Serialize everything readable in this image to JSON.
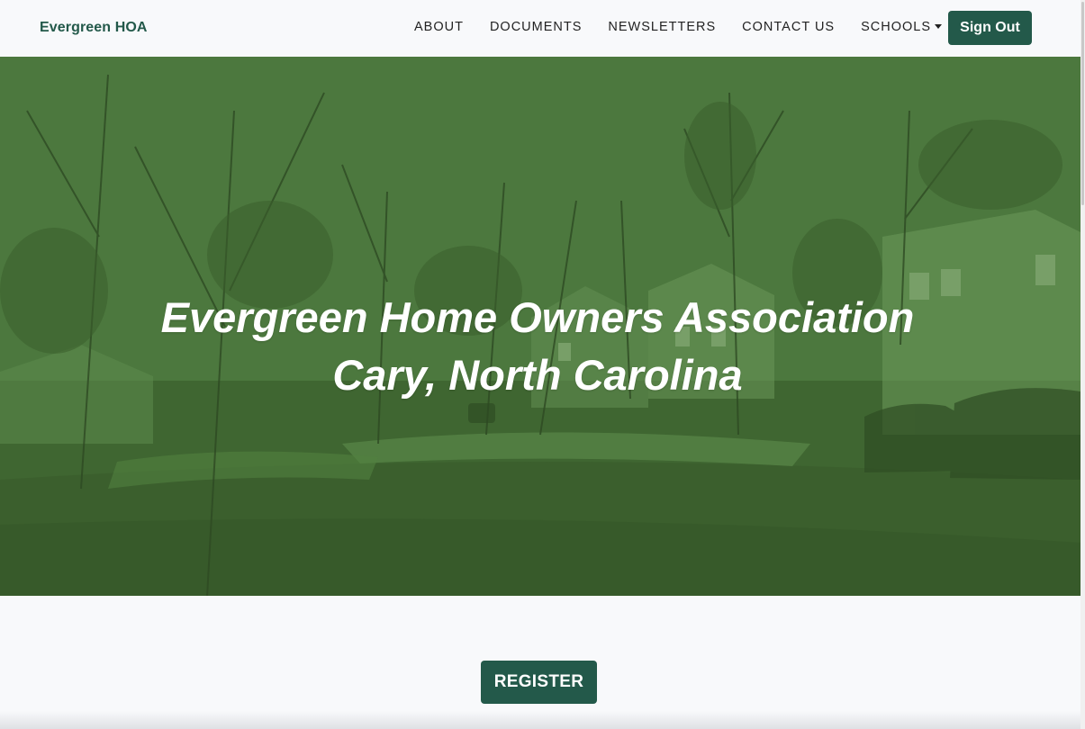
{
  "brand": "Evergreen HOA",
  "nav": {
    "items": [
      {
        "label": "ABOUT"
      },
      {
        "label": "DOCUMENTS"
      },
      {
        "label": "NEWSLETTERS"
      },
      {
        "label": "CONTACT US"
      },
      {
        "label": "SCHOOLS"
      }
    ],
    "signout_label": "Sign Out"
  },
  "hero": {
    "title_line1": "Evergreen Home Owners Association",
    "title_line2": "Cary, North Carolina"
  },
  "register_label": "REGISTER",
  "colors": {
    "primary": "#23594a",
    "hero_tint": "#4b773c",
    "background": "#f8f9fb"
  }
}
